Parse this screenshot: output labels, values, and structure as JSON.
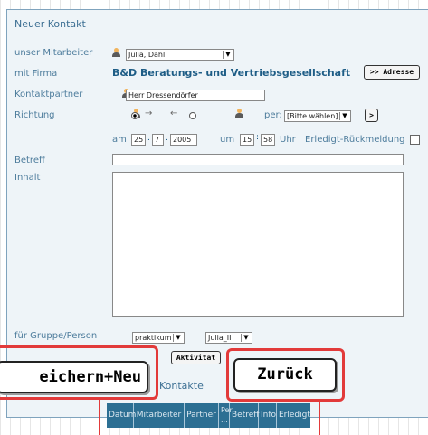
{
  "form": {
    "title": "Neuer Kontakt",
    "labels": {
      "mitarbeiter": "unser Mitarbeiter",
      "firma": "mit Firma",
      "kontaktpartner": "Kontaktpartner",
      "richtung": "Richtung",
      "betreff": "Betreff",
      "inhalt": "Inhalt",
      "gruppe": "für Gruppe/Person"
    },
    "mitarbeiter_value": "Julia, Dahl",
    "firma_name": "B&D Beratungs- und Vertriebsgesellschaft",
    "adresse_button": ">> Adresse",
    "kontaktpartner_value": "Herr Dressendörfer",
    "richtung": {
      "arrow_right": "→",
      "arrow_left": "←",
      "per_label": "per:",
      "per_value": "[Bitte wählen]",
      "go_button": ">"
    },
    "date": {
      "am_label": "am",
      "day": "25",
      "month": "7",
      "year": "2005",
      "um_label": "um",
      "hour": "15",
      "minute": "58",
      "uhr_label": "Uhr",
      "erledigt_label": "Erledigt-Rückmeldung"
    },
    "gruppe_value1": "praktikum",
    "gruppe_value2": "Julia_II"
  },
  "buttons": {
    "speichern_neu": "eichern+Neu",
    "aktivitat": "Aktivitat",
    "zuruck": "Zurück"
  },
  "kontakte": {
    "label": "Kontakte",
    "columns": [
      "Datum",
      "Mitarbeiter",
      "Partner",
      "Per\n...",
      "Betreff",
      "Info",
      "Erledigt"
    ]
  }
}
